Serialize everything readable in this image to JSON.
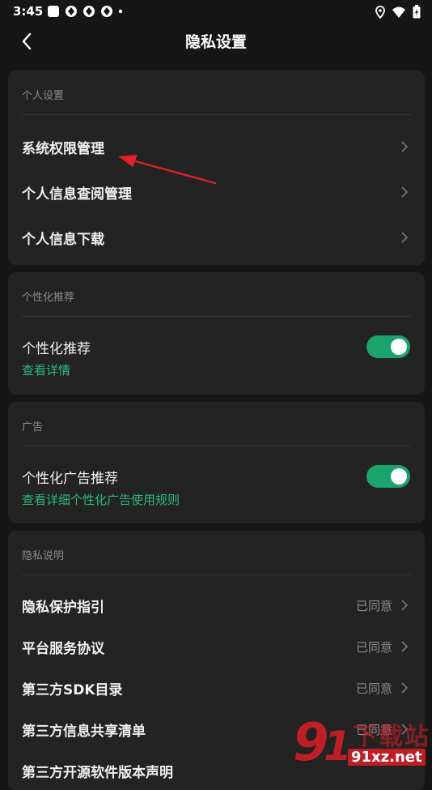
{
  "status_bar": {
    "time": "3:45"
  },
  "header": {
    "title": "隐私设置"
  },
  "personal_settings": {
    "section_title": "个人设置",
    "items": [
      {
        "label": "系统权限管理"
      },
      {
        "label": "个人信息查阅管理"
      },
      {
        "label": "个人信息下载"
      }
    ]
  },
  "personalized_recommend": {
    "section_title": "个性化推荐",
    "toggle_label": "个性化推荐",
    "link": "查看详情",
    "enabled": true
  },
  "ads": {
    "section_title": "广告",
    "toggle_label": "个性化广告推荐",
    "link": "查看详细个性化广告使用规则",
    "enabled": true
  },
  "privacy_notes": {
    "section_title": "隐私说明",
    "items": [
      {
        "label": "隐私保护指引",
        "status": "已同意"
      },
      {
        "label": "平台服务协议",
        "status": "已同意"
      },
      {
        "label": "第三方SDK目录",
        "status": "已同意"
      },
      {
        "label": "第三方信息共享清单",
        "status": "已同意"
      },
      {
        "label": "第三方开源软件版本声明",
        "status": ""
      }
    ]
  },
  "watermark": {
    "text": "91xz.net",
    "text_cn": "下载站"
  },
  "colors": {
    "background": "#161616",
    "card": "#232323",
    "accent": "#1aa36d",
    "link": "#2fb97d",
    "annotation_arrow": "#e0202a"
  }
}
